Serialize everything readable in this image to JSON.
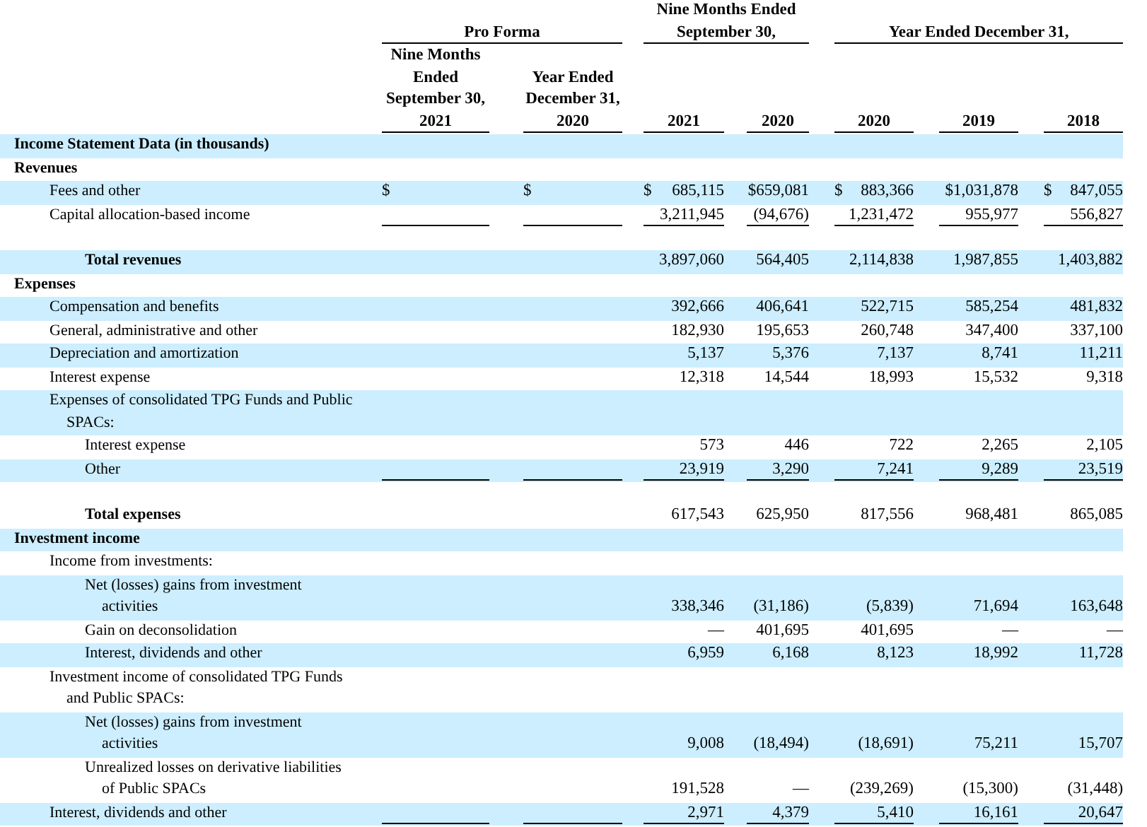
{
  "header": {
    "groups": [
      {
        "label": "Pro Forma",
        "columns": [
          "Nine Months Ended September 30, 2021",
          "Year Ended December 31, 2020"
        ]
      },
      {
        "label": "Nine Months Ended September 30,",
        "columns": [
          "2021",
          "2020"
        ]
      },
      {
        "label": "Year Ended December 31,",
        "columns": [
          "2020",
          "2019",
          "2018"
        ]
      }
    ]
  },
  "rows": [
    {
      "kind": "heading",
      "label": "Income Statement Data (in thousands)",
      "shaded": true
    },
    {
      "kind": "heading",
      "label": "Revenues",
      "shaded": false,
      "children": [
        {
          "kind": "line",
          "label": "Fees and other",
          "shaded": true,
          "pro_forma": [
            {
              "sign": "$"
            },
            {
              "sign": "$"
            }
          ],
          "values": [
            {
              "sign": "$",
              "value": "685,115"
            },
            "$659,081",
            {
              "sign": "$",
              "value": "883,366"
            },
            "$1,031,878",
            {
              "sign": "$",
              "value": "847,055"
            }
          ]
        },
        {
          "kind": "line",
          "label": "Capital allocation-based income",
          "shaded": false,
          "rule_below": true,
          "values": [
            "3,211,945",
            "(94,676)",
            "1,231,472",
            "955,977",
            "556,827"
          ]
        }
      ]
    },
    {
      "kind": "total",
      "label": "Total revenues",
      "shaded": true,
      "space_before": true,
      "values": [
        "3,897,060",
        "564,405",
        "2,114,838",
        "1,987,855",
        "1,403,882"
      ]
    },
    {
      "kind": "heading",
      "label": "Expenses",
      "shaded": false,
      "children": [
        {
          "kind": "line",
          "label": "Compensation and benefits",
          "shaded": true,
          "values": [
            "392,666",
            "406,641",
            "522,715",
            "585,254",
            "481,832"
          ]
        },
        {
          "kind": "line",
          "label": "General, administrative and other",
          "shaded": false,
          "values": [
            "182,930",
            "195,653",
            "260,748",
            "347,400",
            "337,100"
          ]
        },
        {
          "kind": "line",
          "label": "Depreciation and amortization",
          "shaded": true,
          "values": [
            "5,137",
            "5,376",
            "7,137",
            "8,741",
            "11,211"
          ]
        },
        {
          "kind": "line",
          "label": "Interest expense",
          "shaded": false,
          "values": [
            "12,318",
            "14,544",
            "18,993",
            "15,532",
            "9,318"
          ]
        },
        {
          "kind": "line",
          "label": "Expenses of consolidated TPG Funds and Public SPACs:",
          "shaded": true,
          "children": [
            {
              "kind": "line",
              "label": "Interest expense",
              "shaded": false,
              "values": [
                "573",
                "446",
                "722",
                "2,265",
                "2,105"
              ]
            },
            {
              "kind": "line",
              "label": "Other",
              "shaded": true,
              "rule_below": true,
              "values": [
                "23,919",
                "3,290",
                "7,241",
                "9,289",
                "23,519"
              ]
            }
          ]
        }
      ]
    },
    {
      "kind": "total",
      "label": "Total expenses",
      "shaded": false,
      "space_before": true,
      "values": [
        "617,543",
        "625,950",
        "817,556",
        "968,481",
        "865,085"
      ]
    },
    {
      "kind": "heading",
      "label": "Investment income",
      "shaded": true,
      "children": [
        {
          "kind": "line",
          "label": "Income from investments:",
          "shaded": false,
          "children": [
            {
              "kind": "line",
              "label": "Net (losses) gains from investment activities",
              "shaded": true,
              "values": [
                "338,346",
                "(31,186)",
                "(5,839)",
                "71,694",
                "163,648"
              ]
            },
            {
              "kind": "line",
              "label": "Gain on deconsolidation",
              "shaded": false,
              "values": [
                "—",
                "401,695",
                "401,695",
                "—",
                "—"
              ]
            },
            {
              "kind": "line",
              "label": "Interest, dividends and other",
              "shaded": true,
              "values": [
                "6,959",
                "6,168",
                "8,123",
                "18,992",
                "11,728"
              ]
            }
          ]
        },
        {
          "kind": "line",
          "label": "Investment income of consolidated TPG Funds and Public SPACs:",
          "shaded": false,
          "children": [
            {
              "kind": "line",
              "label": "Net (losses) gains from investment activities",
              "shaded": true,
              "values": [
                "9,008",
                "(18,494)",
                "(18,691)",
                "75,211",
                "15,707"
              ]
            },
            {
              "kind": "line",
              "label": "Unrealized losses on derivative liabilities of Public SPACs",
              "shaded": false,
              "values": [
                "191,528",
                "—",
                "(239,269)",
                "(15,300)",
                "(31,448)"
              ]
            }
          ]
        },
        {
          "kind": "line",
          "label": "Interest, dividends and other",
          "shaded": true,
          "rule_below": true,
          "values": [
            "2,971",
            "4,379",
            "5,410",
            "16,161",
            "20,647"
          ]
        }
      ]
    }
  ]
}
